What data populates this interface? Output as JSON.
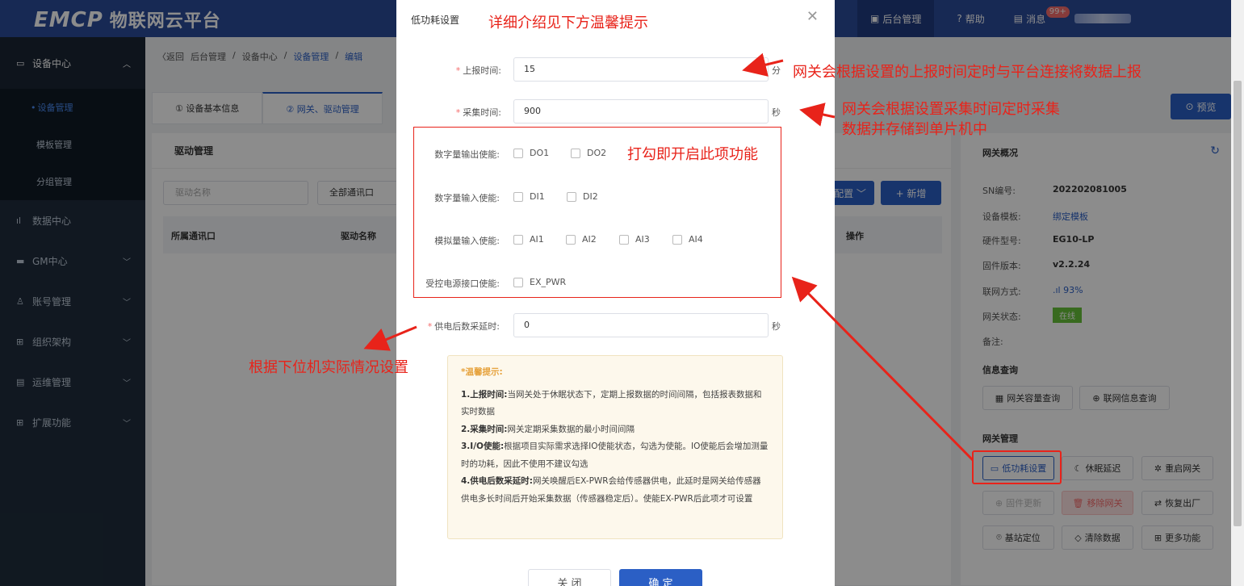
{
  "topbar": {
    "logo": "EMCP",
    "logo_sub": "物联网云平台",
    "nav": [
      {
        "label": "后台管理",
        "icon": "monitor-icon"
      },
      {
        "label": "帮助",
        "icon": "help-icon"
      },
      {
        "label": "消息",
        "icon": "message-icon",
        "badge": "99+"
      }
    ]
  },
  "sidebar": {
    "items": [
      {
        "label": "设备中心",
        "icon": "device-icon"
      },
      {
        "label": "设备管理"
      },
      {
        "label": "模板管理"
      },
      {
        "label": "分组管理"
      },
      {
        "label": "数据中心",
        "icon": "chart-icon"
      },
      {
        "label": "GM中心",
        "icon": "gm-icon"
      },
      {
        "label": "账号管理",
        "icon": "user-icon"
      },
      {
        "label": "组织架构",
        "icon": "org-icon"
      },
      {
        "label": "运维管理",
        "icon": "ops-icon"
      },
      {
        "label": "扩展功能",
        "icon": "grid-icon"
      }
    ]
  },
  "breadcrumb": {
    "back": "〈返回",
    "items": [
      "后台管理",
      "/",
      "设备中心",
      "/",
      "设备管理",
      "/",
      "编辑"
    ]
  },
  "tabs": [
    "① 设备基本信息",
    "② 网关、驱动管理"
  ],
  "drivers": {
    "title": "驱动管理",
    "search_placeholder": "驱动名称",
    "port_select": "全部通讯口",
    "config_button": "配置",
    "add_button": "+ 新增",
    "columns": [
      "所属通讯口",
      "驱动名称",
      "操作"
    ]
  },
  "preview_button": "预览",
  "gateway": {
    "title": "网关概况",
    "fields": [
      {
        "label": "SN编号:",
        "value": "202202081005"
      },
      {
        "label": "设备模板:",
        "value": "绑定模板"
      },
      {
        "label": "硬件型号:",
        "value": "EG10-LP"
      },
      {
        "label": "固件版本:",
        "value": "v2.2.24"
      },
      {
        "label": "联网方式:",
        "value": "93%"
      },
      {
        "label": "网关状态:",
        "value": "在线"
      },
      {
        "label": "备注:",
        "value": ""
      }
    ],
    "info_title": "信息查询",
    "info_buttons": [
      "网关容量查询",
      "联网信息查询"
    ],
    "manage_title": "网关管理",
    "manage_buttons": [
      "低功耗设置",
      "休眠延迟",
      "重启网关",
      "固件更新",
      "移除网关",
      "恢复出厂",
      "基站定位",
      "清除数据",
      "更多功能"
    ]
  },
  "dialog": {
    "title": "低功耗设置",
    "report_label": "上报时间:",
    "report_value": "15",
    "report_unit": "分",
    "collect_label": "采集时间:",
    "collect_value": "900",
    "collect_unit": "秒",
    "do_label": "数字量输出使能:",
    "do_options": [
      "DO1",
      "DO2"
    ],
    "di_label": "数字量输入使能:",
    "di_options": [
      "DI1",
      "DI2"
    ],
    "ai_label": "模拟量输入使能:",
    "ai_options": [
      "AI1",
      "AI2",
      "AI3",
      "AI4"
    ],
    "pwr_label": "受控电源接口使能:",
    "pwr_options": [
      "EX_PWR"
    ],
    "delay_label": "供电后数采延时:",
    "delay_value": "0",
    "delay_unit": "秒",
    "tips_head": "*温馨提示:",
    "tips": [
      {
        "k": "1.上报时间:",
        "v": "当网关处于休眠状态下，定期上报数据的时间间隔，包括报表数据和实时数据"
      },
      {
        "k": "2.采集时间:",
        "v": "网关定期采集数据的最小时间间隔"
      },
      {
        "k": "3.I/O使能:",
        "v": "根据项目实际需求选择IO使能状态，勾选为使能。IO使能后会增加测量时的功耗，因此不使用不建议勾选"
      },
      {
        "k": "4.供电后数采延时:",
        "v": "网关唤醒后EX-PWR会给传感器供电，此延时是网关给传感器供电多长时间后开始采集数据（传感器稳定后）。使能EX-PWR后此项才可设置"
      }
    ],
    "cancel": "关 闭",
    "confirm": "确 定"
  },
  "annotations": {
    "a1": "详细介绍见下方温馨提示",
    "a2": "网关会根据设置的上报时间定时与平台连接将数据上报",
    "a3": "网关会根据设置采集时间定时采集",
    "a3b": "数据并存储到单片机中",
    "a4": "打勾即开启此项功能",
    "a5": "根据下位机实际情况设置"
  },
  "colors": {
    "accent": "#2b5fc5",
    "annotation": "#e8231a",
    "topbar": "#2b4b9a",
    "sidebar": "#1f2d3d"
  }
}
